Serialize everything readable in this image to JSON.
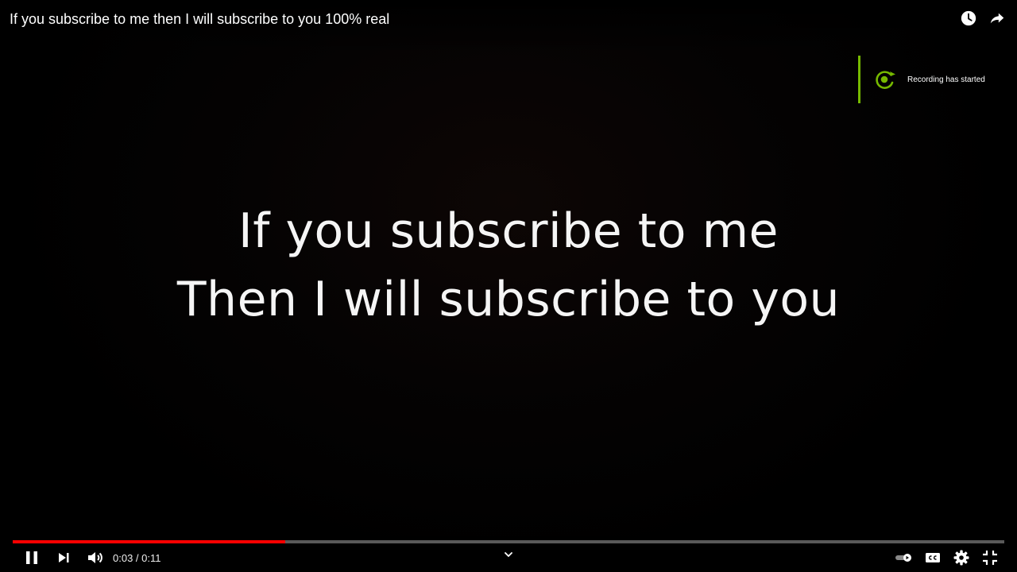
{
  "video": {
    "title": "If you subscribe to me then I will subscribe to you 100% real",
    "lyrics": [
      "If you subscribe to me",
      "Then I will subscribe to you"
    ]
  },
  "header": {
    "icons": [
      "watch-later-icon",
      "share-icon"
    ]
  },
  "notification": {
    "text": "Recording has started",
    "icon": "recording-icon",
    "accent_color": "#76b900"
  },
  "player": {
    "current_time": "0:03",
    "separator": " / ",
    "duration": "0:11",
    "progress_fraction": 0.275,
    "progress_color": "#ff0000",
    "left_icons": [
      "pause-icon",
      "next-icon",
      "volume-icon"
    ],
    "right_icons": [
      "autoplay-toggle-icon",
      "captions-icon",
      "settings-icon",
      "exit-fullscreen-icon"
    ],
    "center_icon": "chevron-down-icon"
  }
}
